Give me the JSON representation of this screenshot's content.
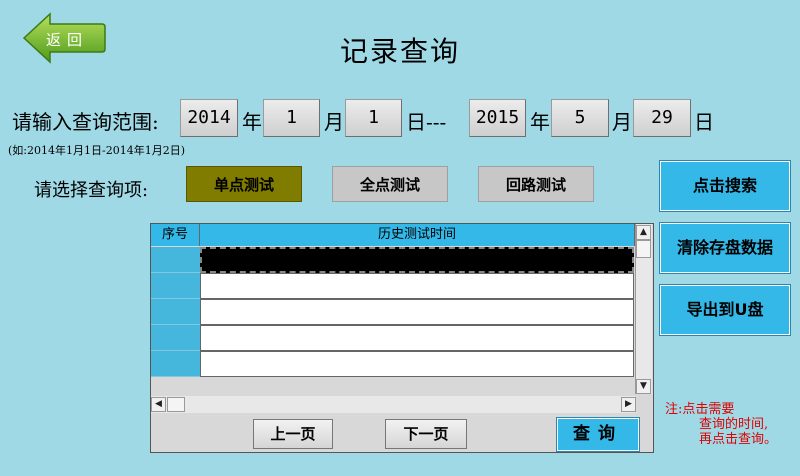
{
  "back": {
    "label": "返回"
  },
  "title": "记录查询",
  "range": {
    "label": "请输入查询范围:",
    "start_year": "2014",
    "start_month": "1",
    "start_day": "1",
    "separator": "日---",
    "end_year": "2015",
    "end_month": "5",
    "end_day": "29",
    "unit_year": "年",
    "unit_month": "月",
    "unit_day": "日"
  },
  "hint": "(如:2014年1月1日-2014年1月2日)",
  "select": {
    "label": "请选择查询项:",
    "options": [
      "单点测试",
      "全点测试",
      "回路测试"
    ],
    "selected": "单点测试"
  },
  "actions": {
    "search": "点击搜索",
    "clear": "清除存盘数据",
    "export": "导出到U盘"
  },
  "table": {
    "headers": [
      "序号",
      "历史测试时间"
    ],
    "rows": [
      "",
      "",
      "",
      "",
      ""
    ]
  },
  "pagination": {
    "prev": "上一页",
    "next": "下一页",
    "query": "查询"
  },
  "note": {
    "line1": "注:点击需要",
    "line2": "查询的时间,",
    "line3": "再点击查询。"
  },
  "colors": {
    "background": "#9fd9e6",
    "accent": "#33b8e8",
    "selected_option": "#807c00",
    "note": "#e00000"
  }
}
